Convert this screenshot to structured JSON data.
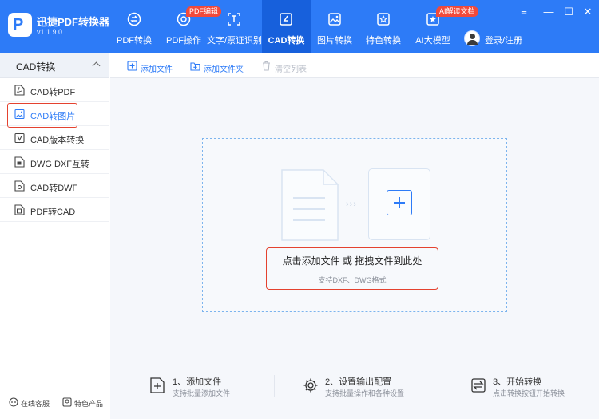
{
  "app": {
    "name": "迅捷PDF转换器",
    "version": "v1.1.9.0",
    "logo_letter": "P"
  },
  "nav": [
    {
      "label": "PDF转换",
      "icon": "pdf-convert-icon"
    },
    {
      "label": "PDF操作",
      "icon": "pdf-operate-icon",
      "badge": "PDF编辑"
    },
    {
      "label": "文字/票证识别",
      "icon": "ocr-icon"
    },
    {
      "label": "CAD转换",
      "icon": "cad-convert-icon",
      "active": true
    },
    {
      "label": "图片转换",
      "icon": "image-convert-icon"
    },
    {
      "label": "特色转换",
      "icon": "special-convert-icon"
    },
    {
      "label": "AI大模型",
      "icon": "ai-model-icon",
      "badge": "AI解读文档"
    }
  ],
  "login": {
    "label": "登录/注册"
  },
  "window_controls": {
    "menu": "≡",
    "minimize": "—",
    "maximize": "☐",
    "close": "✕"
  },
  "sidebar": {
    "header": "CAD转换",
    "items": [
      {
        "label": "CAD转PDF",
        "icon": "pdf-file-icon"
      },
      {
        "label": "CAD转图片",
        "icon": "image-file-icon",
        "active": true
      },
      {
        "label": "CAD版本转换",
        "icon": "version-icon"
      },
      {
        "label": "DWG DXF互转",
        "icon": "swap-file-icon"
      },
      {
        "label": "CAD转DWF",
        "icon": "dwf-file-icon"
      },
      {
        "label": "PDF转CAD",
        "icon": "cad-file-icon"
      }
    ],
    "footer": {
      "support": "在线客服",
      "products": "特色产品"
    }
  },
  "toolbar": {
    "add_file": "添加文件",
    "add_folder": "添加文件夹",
    "clear_list": "清空列表"
  },
  "dropzone": {
    "title": "点击添加文件 或 拖拽文件到此处",
    "subtitle": "支持DXF、DWG格式",
    "arrows": "›››"
  },
  "steps": [
    {
      "title": "1、添加文件",
      "desc": "支持批量添加文件"
    },
    {
      "title": "2、设置输出配置",
      "desc": "支持批量操作和各种设置"
    },
    {
      "title": "3、开始转换",
      "desc": "点击转换按钮开始转换"
    }
  ],
  "colors": {
    "brand": "#2d7bf7",
    "nav_active": "#1760dc",
    "badge": "#f14a3b",
    "highlight": "#e4422f"
  }
}
